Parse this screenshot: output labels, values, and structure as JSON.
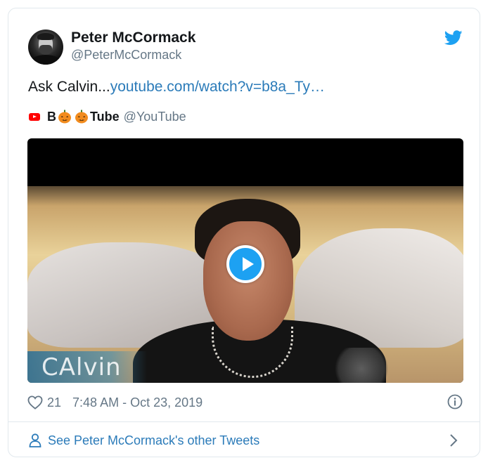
{
  "author": {
    "name": "Peter McCormack",
    "handle": "@PeterMcCormack"
  },
  "tweet": {
    "text": "Ask Calvin...",
    "link_text": "youtube.com/watch?v=b8a_Ty…"
  },
  "source": {
    "name_prefix": "B",
    "name_suffix": "Tube",
    "handle": "@YouTube"
  },
  "video": {
    "watermark": "CAlvin"
  },
  "meta": {
    "likes": "21",
    "timestamp": "7:48 AM - Oct 23, 2019"
  },
  "footer": {
    "label": "See Peter McCormack's other Tweets"
  },
  "colors": {
    "link": "#2b7bb9",
    "twitter_blue": "#1da1f2",
    "youtube_red": "#ff0000",
    "muted": "#657786",
    "pumpkin": "#f28c1e"
  },
  "icons": [
    "twitter-bird-icon",
    "youtube-icon",
    "pumpkin-icon",
    "play-icon",
    "heart-icon",
    "info-icon",
    "person-icon",
    "chevron-right-icon"
  ]
}
